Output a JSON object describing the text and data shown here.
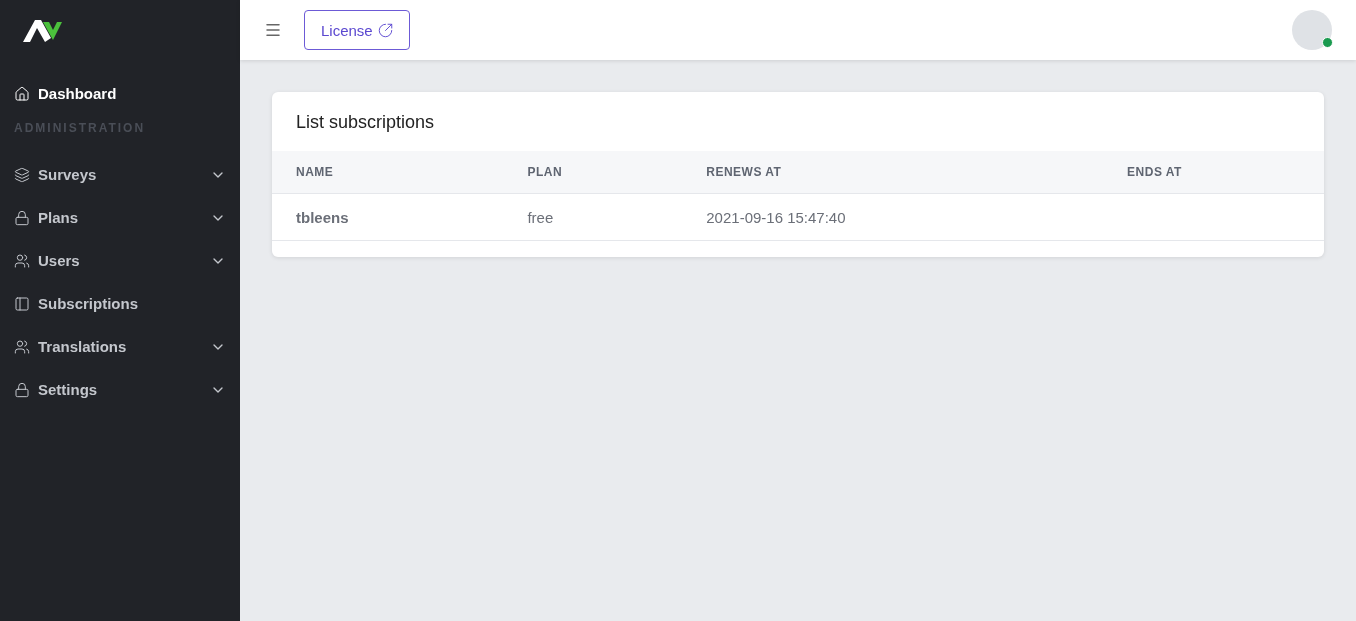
{
  "sidebar": {
    "items": [
      {
        "label": "Dashboard",
        "selected": true,
        "expandable": false
      }
    ],
    "section": "ADMINISTRATION",
    "admin_items": [
      {
        "label": "Surveys",
        "selected": false,
        "expandable": true
      },
      {
        "label": "Plans",
        "selected": false,
        "expandable": true
      },
      {
        "label": "Users",
        "selected": false,
        "expandable": true
      },
      {
        "label": "Subscriptions",
        "selected": false,
        "expandable": false
      },
      {
        "label": "Translations",
        "selected": false,
        "expandable": true
      },
      {
        "label": "Settings",
        "selected": false,
        "expandable": true
      }
    ]
  },
  "topbar": {
    "license_button": "License",
    "user_online": true
  },
  "card": {
    "title": "List subscriptions",
    "columns": [
      "NAME",
      "PLAN",
      "RENEWS AT",
      "ENDS AT"
    ],
    "rows": [
      [
        "tbleens",
        "free",
        "2021-09-16 15:47:40",
        ""
      ]
    ]
  }
}
